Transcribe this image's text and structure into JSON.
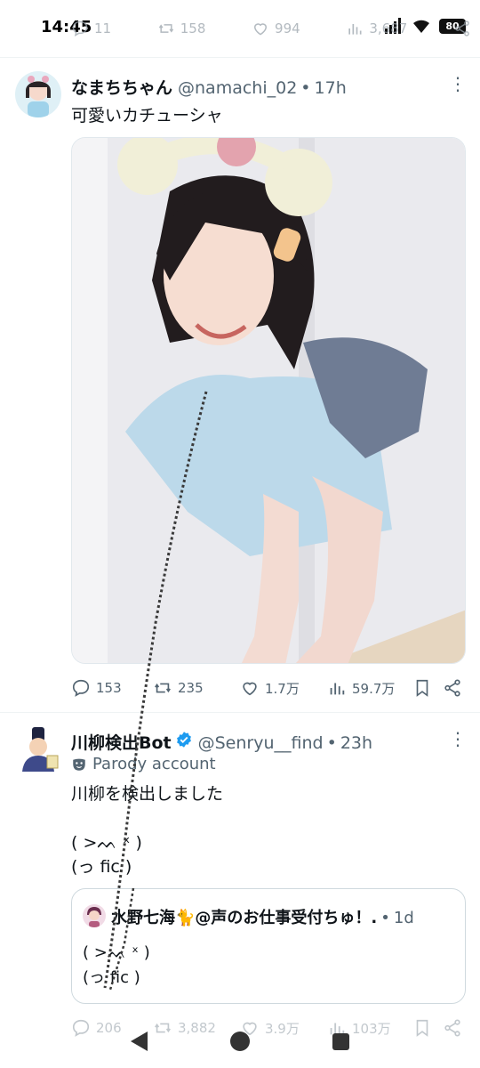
{
  "status": {
    "time": "14:45",
    "battery": "80"
  },
  "prev_actions": {
    "replies": "11",
    "reposts": "158",
    "likes": "994",
    "views": "3,687"
  },
  "tweet1": {
    "name": "なまちちゃん",
    "handle": "@namachi_02",
    "time": "17h",
    "text": "可愛いカチューシャ",
    "replies": "153",
    "reposts": "235",
    "likes": "1.7万",
    "views": "59.7万"
  },
  "tweet2": {
    "name": "川柳検出Bot",
    "handle": "@Senryu__find",
    "time": "23h",
    "badge": "Parody account",
    "text": "川柳を検出しました",
    "kaomoji_1": "( >ᨓ ˣ )",
    "kaomoji_2": "(っ fic )",
    "replies": "206",
    "reposts": "3,882",
    "likes": "3.9万",
    "views": "103万"
  },
  "quote": {
    "name": "水野七海🐈@声のお仕事受付ちゅ！.",
    "time": "1d",
    "line1": "( >ᨓ ˣ )",
    "line2": "(っ fic )"
  },
  "colors": {
    "text": "#0f1419",
    "muted": "#536471",
    "verified": "#1d9bf0",
    "border": "#cfd9de"
  }
}
